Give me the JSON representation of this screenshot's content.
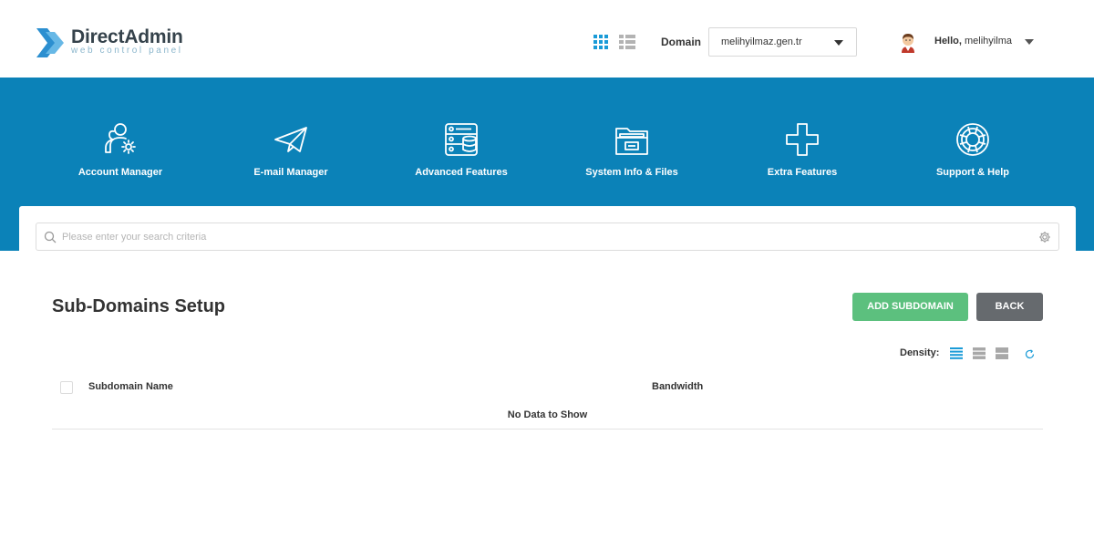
{
  "header": {
    "logo_name": "DirectAdmin",
    "logo_tagline": "web control panel",
    "domain_label": "Domain",
    "domain_value": "melihyilmaz.gen.tr",
    "greeting": "Hello,",
    "username": "melihyilma"
  },
  "nav": {
    "items": [
      {
        "label": "Account Manager",
        "icon": "account-manager-icon"
      },
      {
        "label": "E-mail Manager",
        "icon": "paper-plane-icon"
      },
      {
        "label": "Advanced Features",
        "icon": "server-database-icon"
      },
      {
        "label": "System Info & Files",
        "icon": "folder-icon"
      },
      {
        "label": "Extra Features",
        "icon": "plus-icon"
      },
      {
        "label": "Support & Help",
        "icon": "lifebuoy-icon"
      }
    ]
  },
  "search": {
    "placeholder": "Please enter your search criteria"
  },
  "main": {
    "title": "Sub-Domains Setup",
    "add_button": "ADD SUBDOMAIN",
    "back_button": "BACK",
    "density_label": "Density:",
    "table": {
      "columns": [
        "Subdomain Name",
        "Bandwidth"
      ],
      "rows": [],
      "empty_message": "No Data to Show"
    }
  },
  "colors": {
    "brand_blue": "#0b82b8",
    "add_green": "#5cc07e",
    "back_gray": "#666a6e",
    "active_accent": "#1a9bd7"
  }
}
